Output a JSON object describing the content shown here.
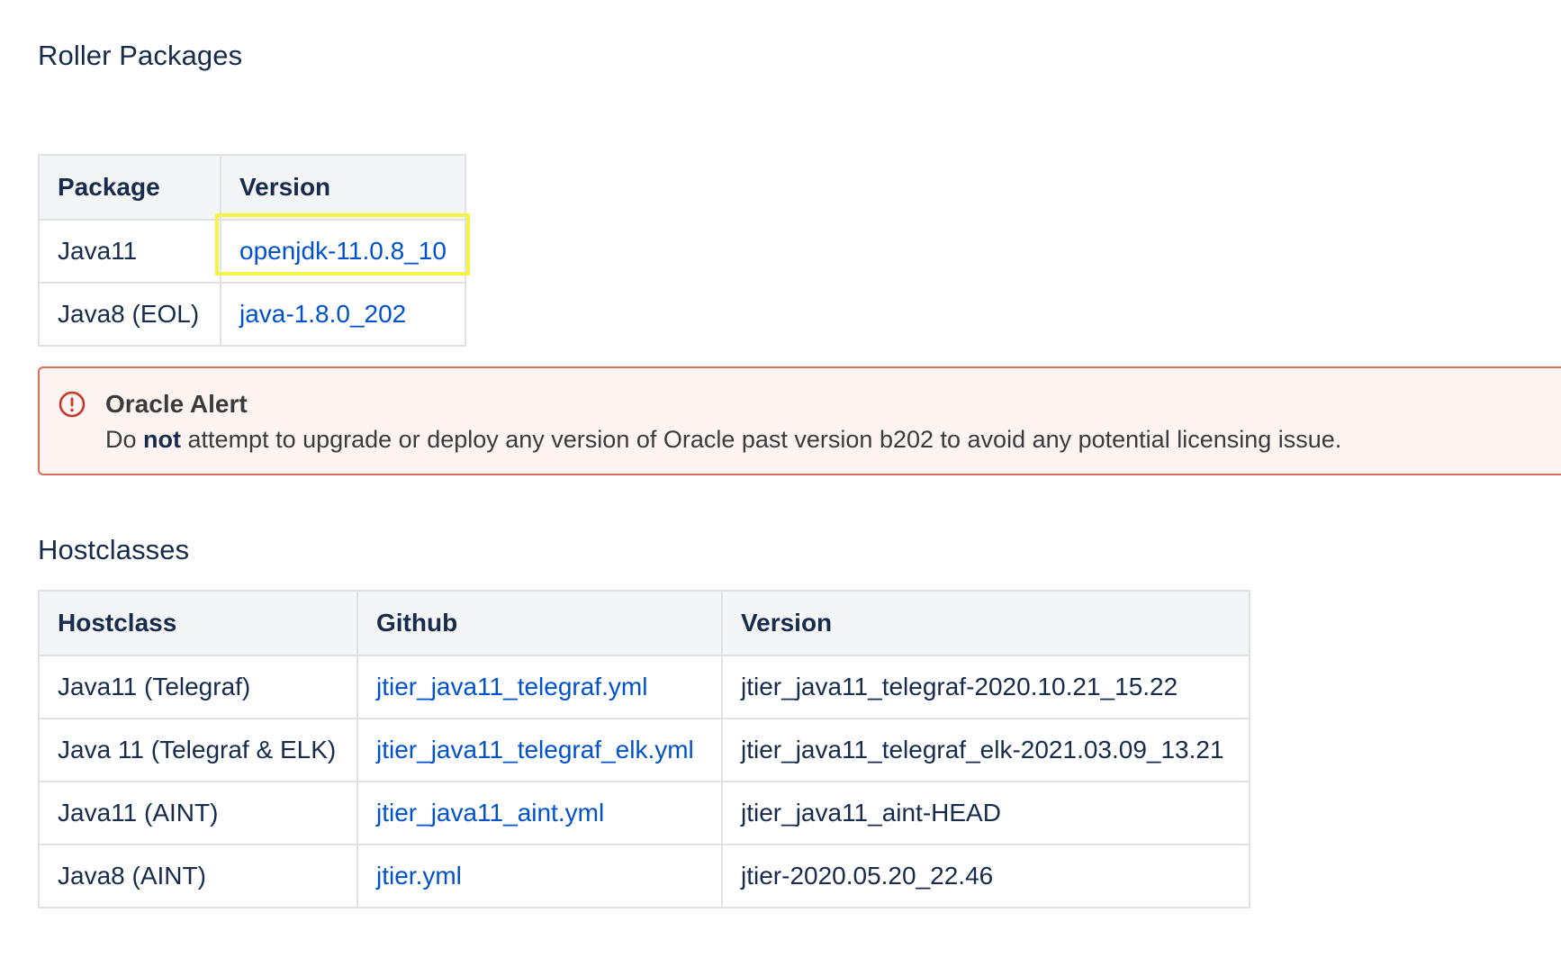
{
  "roller": {
    "title": "Roller Packages",
    "headers": [
      "Package",
      "Version"
    ],
    "rows": [
      {
        "package": "Java11",
        "version": "openjdk-11.0.8_10"
      },
      {
        "package": "Java8 (EOL)",
        "version": "java-1.8.0_202"
      }
    ]
  },
  "alert": {
    "icon": "error-circle-icon",
    "title": "Oracle Alert",
    "body_prefix": "Do",
    "body_bold": "not",
    "body_suffix": "attempt to upgrade or deploy any version of Oracle past version b202 to avoid any potential licensing issue.",
    "border_color": "#de6d5b",
    "background_color": "#fdf4f2"
  },
  "hostclasses": {
    "title": "Hostclasses",
    "headers": [
      "Hostclass",
      "Github",
      "Version"
    ],
    "rows": [
      {
        "hostclass": "Java11 (Telegraf)",
        "github": "jtier_java11_telegraf.yml",
        "version": "jtier_java11_telegraf-2020.10.21_15.22"
      },
      {
        "hostclass": "Java 11 (Telegraf & ELK)",
        "github": "jtier_java11_telegraf_elk.yml",
        "version": "jtier_java11_telegraf_elk-2021.03.09_13.21"
      },
      {
        "hostclass": "Java11 (AINT)",
        "github": "jtier_java11_aint.yml",
        "version": "jtier_java11_aint-HEAD"
      },
      {
        "hostclass": "Java8 (AINT)",
        "github": "jtier.yml",
        "version": "jtier-2020.05.20_22.46"
      }
    ]
  },
  "colors": {
    "link": "#0052cc",
    "text": "#172b4d",
    "highlight": "#f5f345"
  }
}
